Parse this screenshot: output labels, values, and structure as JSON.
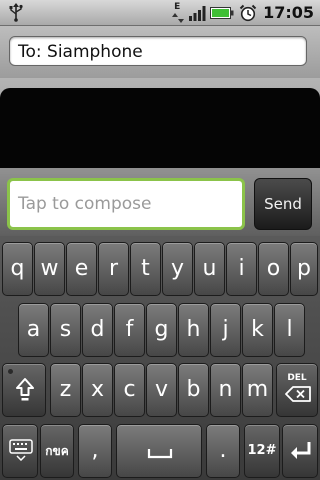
{
  "status_bar": {
    "network_label": "E",
    "time": "17:05",
    "usb_icon": "usb-icon",
    "signal_icon": "signal-icon",
    "battery_icon": "battery-icon",
    "alarm_icon": "alarm-icon",
    "battery_color": "#3fbf35"
  },
  "recipient": {
    "text": "To: Siamphone"
  },
  "compose": {
    "placeholder": "Tap to compose",
    "send_label": "Send",
    "accent": "#8bc34a"
  },
  "keyboard": {
    "row1": [
      "q",
      "w",
      "e",
      "r",
      "t",
      "y",
      "u",
      "i",
      "o",
      "p"
    ],
    "row2": [
      "a",
      "s",
      "d",
      "f",
      "g",
      "h",
      "j",
      "k",
      "l"
    ],
    "row3": [
      "z",
      "x",
      "c",
      "v",
      "b",
      "n",
      "m"
    ],
    "shift_icon": "shift-icon",
    "del_label": "DEL",
    "del_icon": "backspace-icon",
    "keyboard_icon": "keyboard-settings-icon",
    "lang_label": "กขค",
    "comma": ",",
    "space_icon": "space-icon",
    "period": ".",
    "symbols_label": "12#",
    "enter_icon": "enter-icon"
  }
}
